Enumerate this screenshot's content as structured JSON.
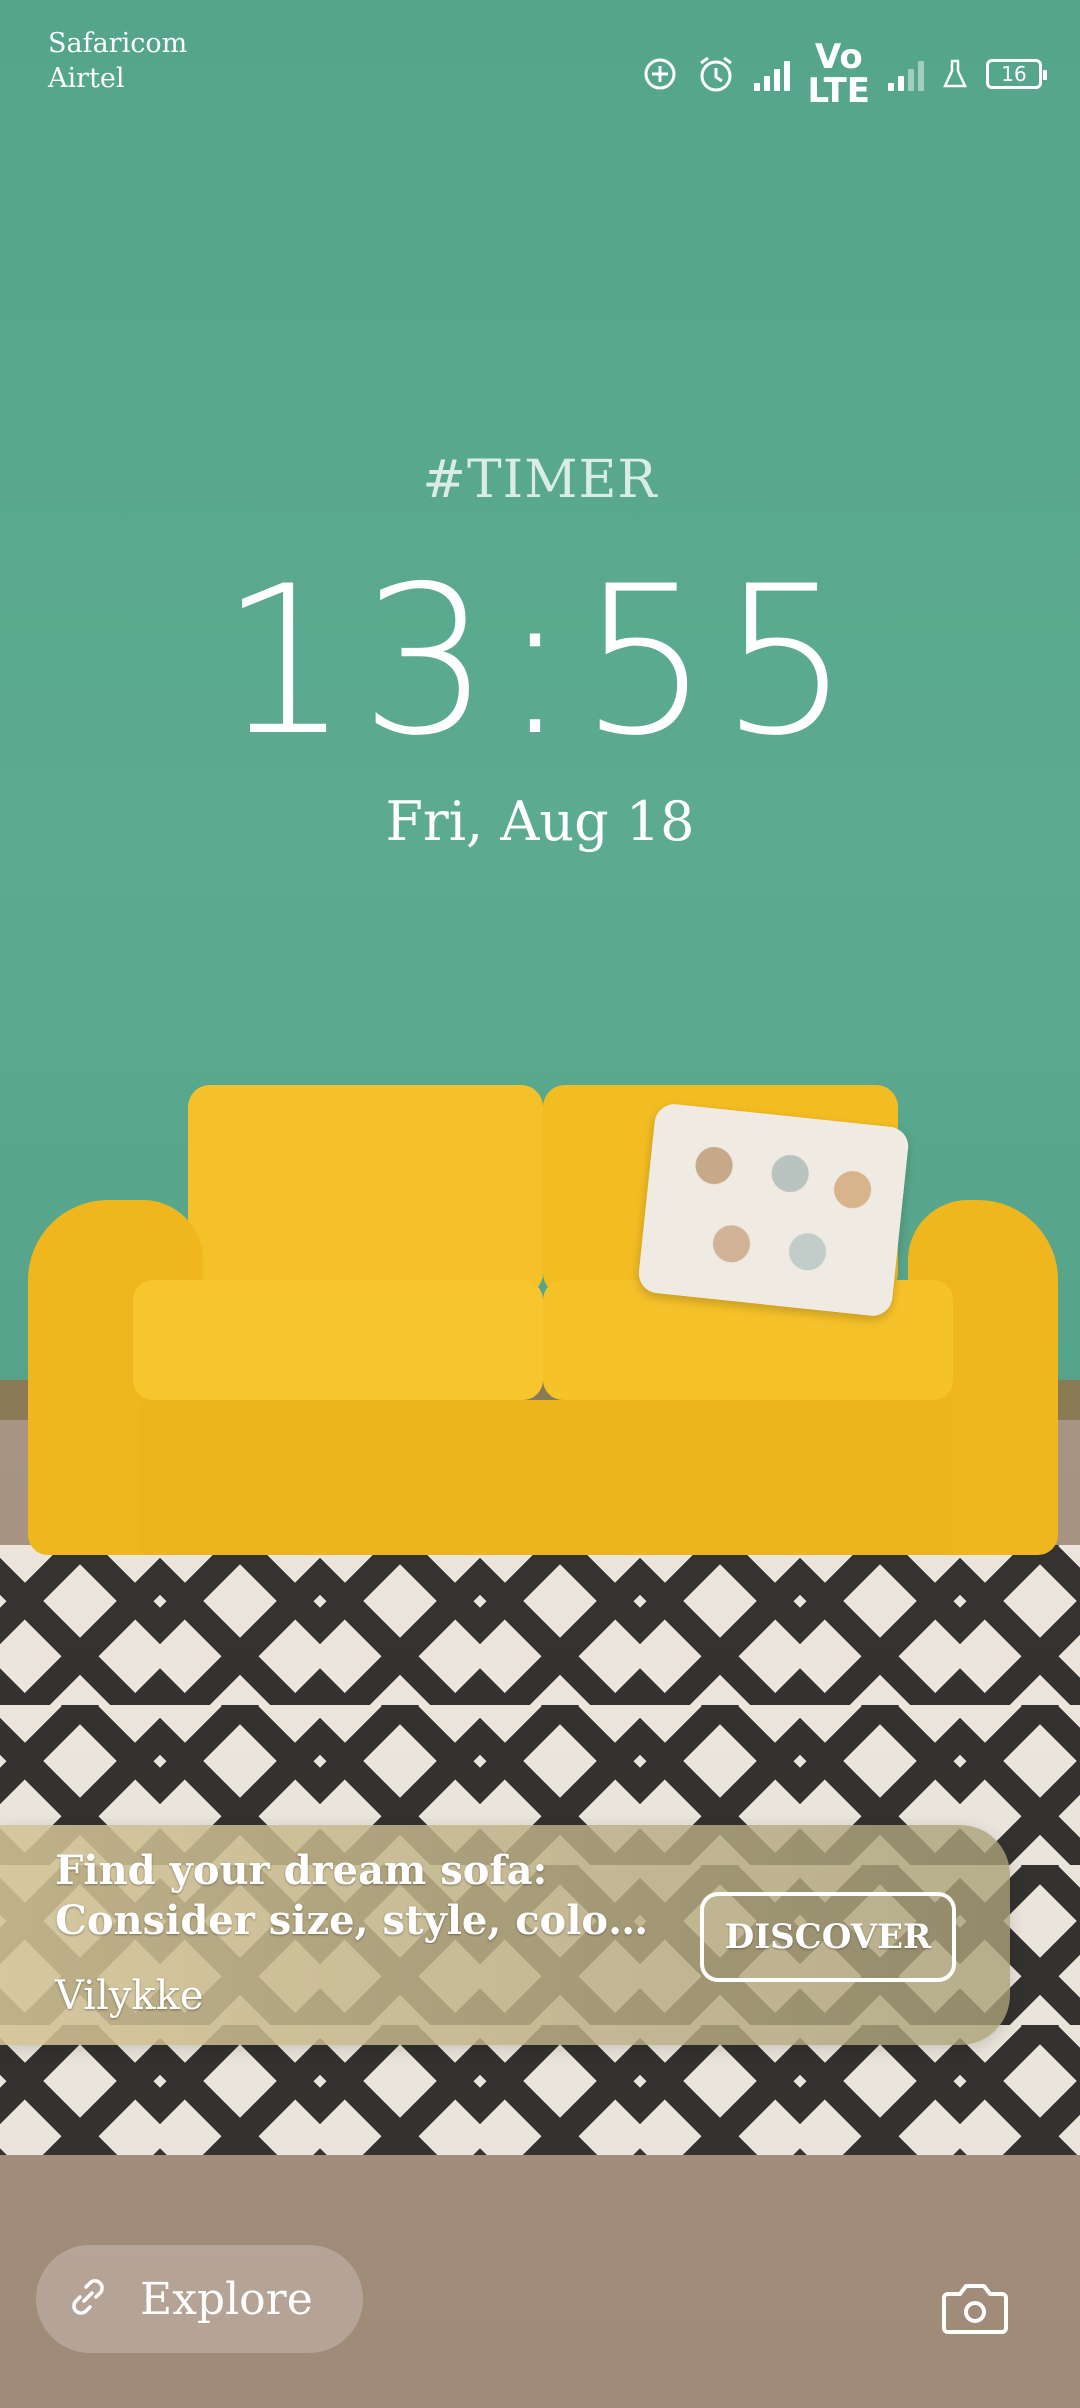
{
  "status_bar": {
    "carrier_1": "Safaricom",
    "carrier_2": "Airtel",
    "icons": [
      "data-saver-icon",
      "alarm-icon",
      "signal-icon",
      "volte-icon",
      "signal-weak-icon",
      "lab-icon",
      "battery-icon"
    ],
    "volte_top": "Vo",
    "volte_bottom": "LTE",
    "battery_level": "16"
  },
  "lockscreen": {
    "tag": "#TIMER",
    "time": "13:55",
    "date": "Fri, Aug 18"
  },
  "promo": {
    "title": "Find your dream sofa:",
    "subtitle": "Consider size, style, color, m...",
    "brand": "Vilykke",
    "button_label": "DISCOVER"
  },
  "bottom": {
    "explore_label": "Explore",
    "explore_icon": "link-icon",
    "camera_icon": "camera-icon"
  },
  "colors": {
    "wall": "#5aa98e",
    "sofa": "#f5c12a"
  }
}
